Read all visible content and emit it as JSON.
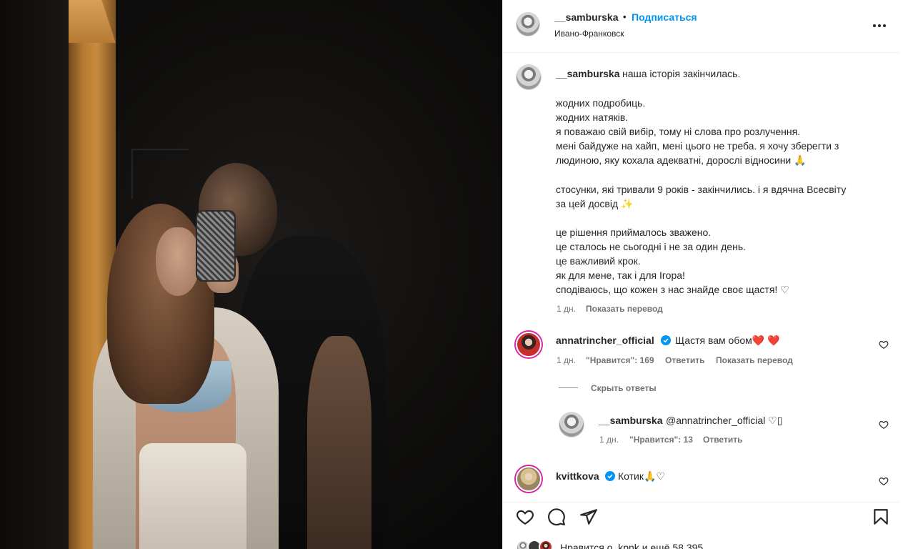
{
  "header": {
    "username": "__samburska",
    "dot": "•",
    "follow_label": "Подписаться",
    "location": "Ивано-Франковск",
    "more_icon": "more-horizontal-icon"
  },
  "caption": {
    "username": "__samburska",
    "first_line": "наша історія закінчилась.",
    "lines": [
      "жодних подробиць.",
      "жодних натяків.",
      "я поважаю свій вибір, тому ні слова про розлучення.",
      "мені байдуже на хайп, мені цього не треба. я хочу зберегти з",
      "людиною, яку кохала адекватні, дорослі відносини 🙏",
      "стосунки, які тривали 9 років - закінчились. і я вдячна Всесвіту",
      "за цей досвід ✨",
      "це рішення приймалось зважено.",
      "це сталось не сьогодні і не за один день.",
      "це важливий крок.",
      "як для мене, так і для Ігора!",
      "сподіваюсь, що кожен з нас знайде своє щастя! ♡"
    ],
    "time": "1 дн.",
    "translate": "Показать перевод"
  },
  "comments": [
    {
      "username": "annatrincher_official",
      "text": "Щастя вам обом❤️ ❤️",
      "time": "1 дн.",
      "likes": "\"Нравится\": 169",
      "reply": "Ответить",
      "translate": "Показать перевод",
      "verified": true
    },
    {
      "username": "kvittkova",
      "text": "Котик🙏♡",
      "verified": true
    }
  ],
  "hide_replies": "Скрыть ответы",
  "reply": {
    "username": "__samburska",
    "text": "@annatrincher_official ♡▯",
    "time": "1 дн.",
    "likes": "\"Нравится\": 13",
    "reply": "Ответить"
  },
  "likes_bar": {
    "text": "Нравится o_kpnk и ещё 58 395"
  },
  "colors": {
    "link_blue": "#0095f6",
    "verified_blue": "#0095f6",
    "muted_text": "#737373"
  }
}
